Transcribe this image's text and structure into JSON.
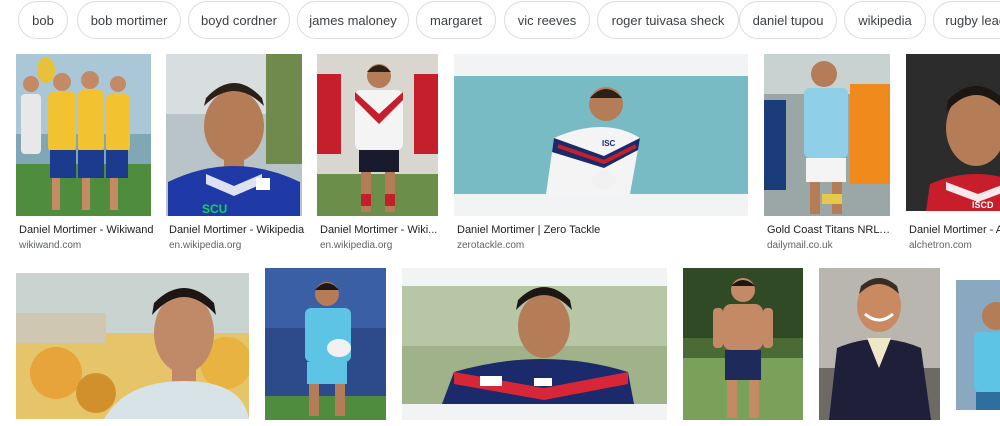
{
  "chips": [
    "bob",
    "bob mortimer",
    "boyd cordner",
    "james maloney",
    "margaret",
    "vic reeves",
    "roger tuivasa sheck",
    "daniel tupou",
    "wikipedia",
    "rugby league"
  ],
  "results_row1": [
    {
      "title": "Daniel Mortimer - Wikiwand",
      "source": "wikiwand.com"
    },
    {
      "title": "Daniel Mortimer - Wikipedia",
      "source": "en.wikipedia.org"
    },
    {
      "title": "Daniel Mortimer - Wiki...",
      "source": "en.wikipedia.org"
    },
    {
      "title": "Daniel Mortimer | Zero Tackle",
      "source": "zerotackle.com"
    },
    {
      "title": "Gold Coast Titans NRL ...",
      "source": "dailymail.co.uk"
    },
    {
      "title": "Daniel Mortimer - Al",
      "source": "alchetron.com"
    }
  ],
  "image_text": {
    "scu": "SCU",
    "isc": "ISC",
    "iscd": "ISCD"
  },
  "colors": {
    "chip_border": "#dadce0",
    "caption": "#202124",
    "source": "#5f6368"
  }
}
